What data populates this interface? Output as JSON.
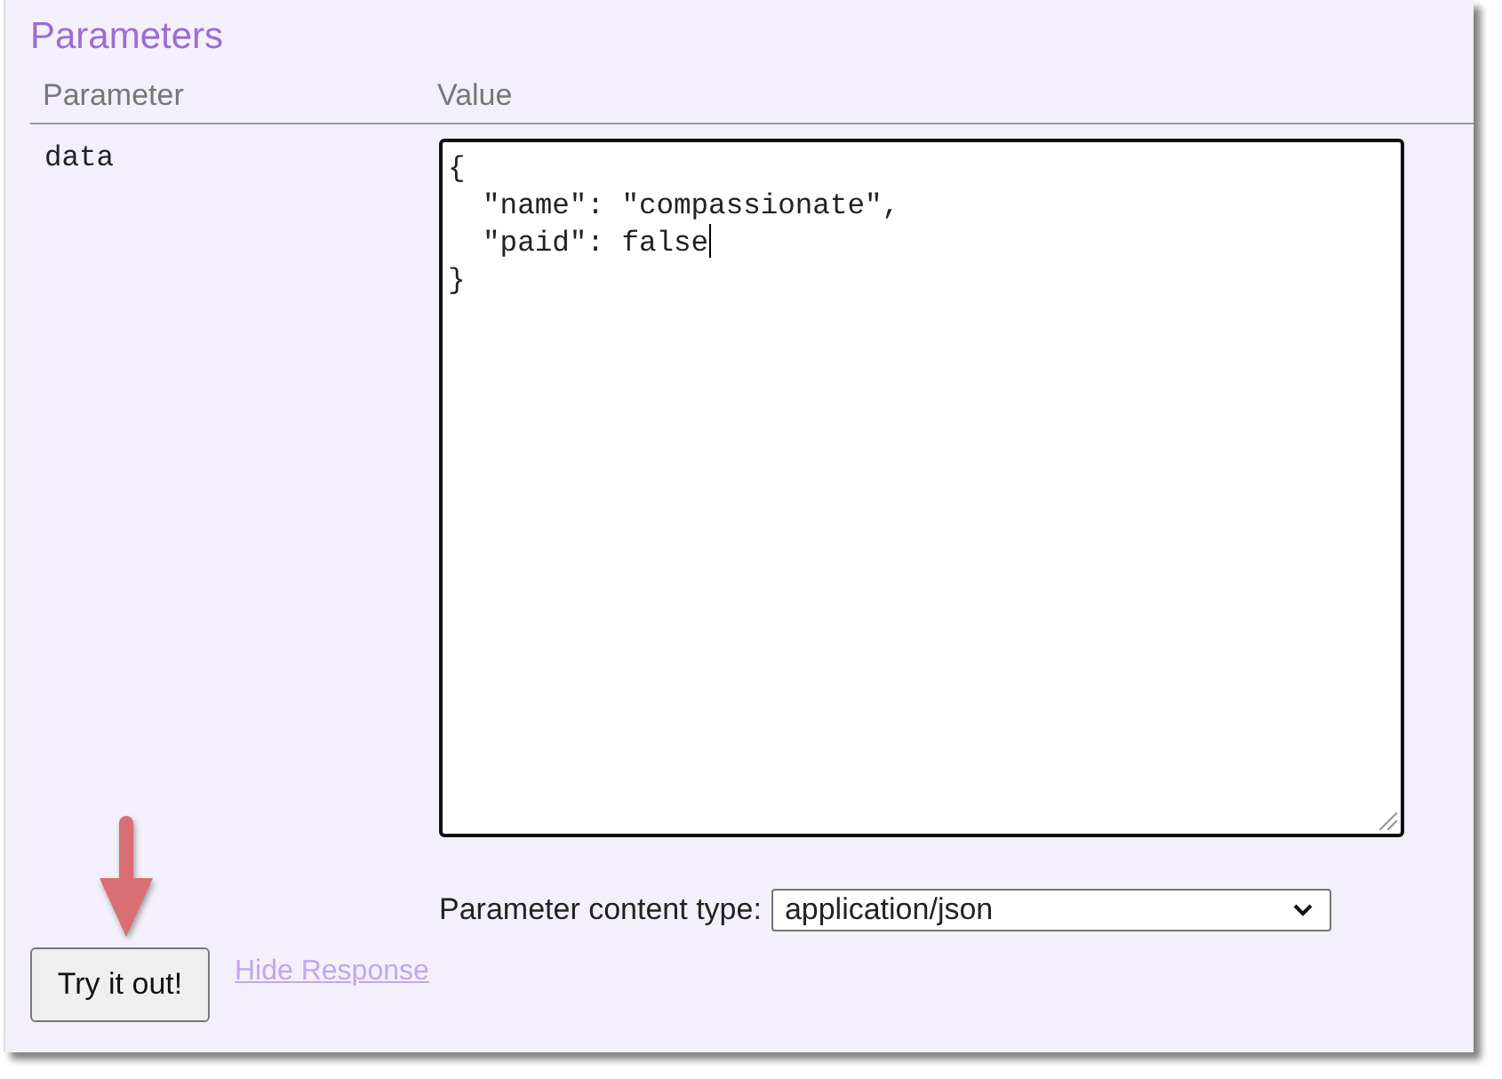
{
  "section": {
    "title": "Parameters"
  },
  "table": {
    "columns": [
      "Parameter",
      "Value"
    ],
    "rows": [
      {
        "name": "data",
        "focused": true,
        "lines": [
          {
            "text": "{",
            "cursor": false
          },
          {
            "text": "  \"name\": \"compassionate\",",
            "cursor": false
          },
          {
            "text": "  \"paid\": false",
            "cursor": true
          },
          {
            "text": "}",
            "cursor": false
          }
        ]
      }
    ]
  },
  "content_type": {
    "label": "Parameter content type:",
    "value": "application/json"
  },
  "actions": {
    "button": "Try it out!",
    "link": "Hide Response"
  }
}
